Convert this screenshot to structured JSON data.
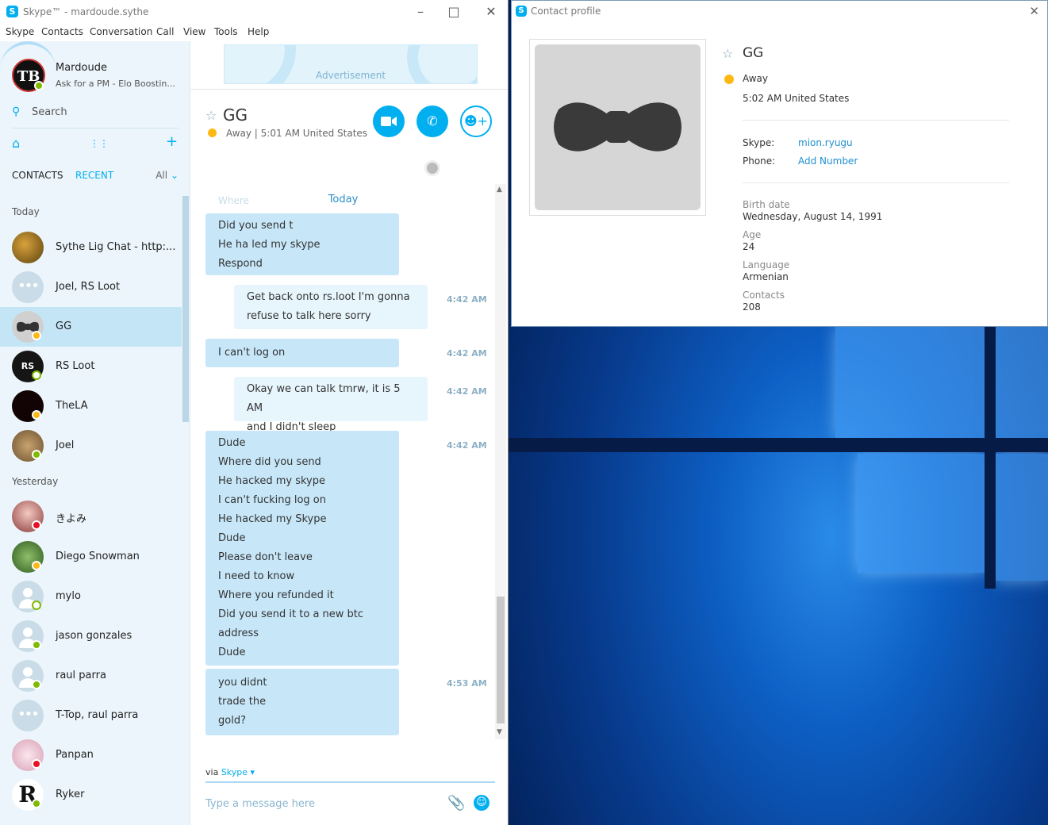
{
  "skype_window": {
    "title": "Skype™ - mardoude.sythe",
    "menu": [
      "Skype",
      "Contacts",
      "Conversation",
      "Call",
      "View",
      "Tools",
      "Help"
    ]
  },
  "me": {
    "name": "Mardoude",
    "mood": "Ask for a PM - Elo Boostin...",
    "avatar_text": "TB",
    "status": "online"
  },
  "search": {
    "label": "Search"
  },
  "tabs": {
    "contacts": "CONTACTS",
    "recent": "RECENT",
    "filter": "All"
  },
  "sections": {
    "today": "Today",
    "yesterday": "Yesterday"
  },
  "recent_today": [
    {
      "name": "Sythe Lig Chat - http:...",
      "avatar": "image",
      "status": ""
    },
    {
      "name": "Joel, RS Loot",
      "avatar": "group",
      "status": ""
    },
    {
      "name": "GG",
      "avatar": "bowtie",
      "status": "away",
      "selected": true
    },
    {
      "name": "RS Loot",
      "avatar": "image",
      "status": "offline"
    },
    {
      "name": "TheLA",
      "avatar": "image",
      "status": "away"
    },
    {
      "name": "Joel",
      "avatar": "image",
      "status": "online"
    }
  ],
  "recent_yesterday": [
    {
      "name": "きよみ",
      "avatar": "image",
      "status": "busy"
    },
    {
      "name": "Diego Snowman",
      "avatar": "image",
      "status": "away"
    },
    {
      "name": "mylo",
      "avatar": "generic",
      "status": "offline"
    },
    {
      "name": "jason gonzales",
      "avatar": "generic",
      "status": "online"
    },
    {
      "name": "raul parra",
      "avatar": "generic",
      "status": "online"
    },
    {
      "name": "T-Top, raul parra",
      "avatar": "group",
      "status": ""
    },
    {
      "name": "Panpan",
      "avatar": "image",
      "status": "busy"
    },
    {
      "name": "Ryker",
      "avatar": "image",
      "status": "online"
    }
  ],
  "ad": {
    "label": "Advertisement"
  },
  "conversation": {
    "contact_name": "GG",
    "status_line": "Away  |  5:01 AM United States",
    "today_label": "Today",
    "faded_lines": [
      "Where"
    ],
    "messages": [
      {
        "from": "them",
        "lines": [
          "Did you send t",
          "He ha led my skype",
          "Respond"
        ],
        "time": ""
      },
      {
        "from": "me",
        "lines": [
          "Get back onto rs.loot I'm gonna",
          "refuse to talk here sorry"
        ],
        "time": "4:42 AM"
      },
      {
        "from": "them",
        "lines": [
          "I can't log on"
        ],
        "time": "4:42 AM"
      },
      {
        "from": "me",
        "lines": [
          "Okay we can talk tmrw, it is 5 AM",
          "and I didn't sleep"
        ],
        "time": "4:42 AM"
      },
      {
        "from": "them",
        "lines": [
          "Dude",
          "Where did you send",
          "He hacked my skype",
          "I can't fucking log on",
          "He hacked my Skype",
          "Dude",
          "Please don't leave",
          "I need to know",
          "Where you refunded it",
          "Did you send it to a new btc",
          "address",
          "Dude"
        ],
        "time": "4:42 AM"
      },
      {
        "from": "them",
        "lines": [
          "you didnt",
          "trade the",
          "gold?"
        ],
        "time": "4:53 AM"
      }
    ],
    "via_prefix": "via",
    "via_service": "Skype ▾",
    "compose_placeholder": "Type a message here"
  },
  "contact_profile": {
    "title": "Contact profile",
    "name": "GG",
    "status": "Away",
    "local_time": "5:02 AM United States",
    "skype_label": "Skype:",
    "skype_value": "mion.ryugu",
    "phone_label": "Phone:",
    "phone_value": "Add Number",
    "fields": [
      {
        "label": "Birth date",
        "value": "Wednesday, August 14, 1991"
      },
      {
        "label": "Age",
        "value": "24"
      },
      {
        "label": "Language",
        "value": "Armenian"
      },
      {
        "label": "Contacts",
        "value": "208"
      }
    ]
  },
  "colors": {
    "skype_blue": "#00aff0",
    "bubble_them": "#c7e7f9",
    "bubble_me": "#e7f5fd",
    "away": "#fdb813",
    "online": "#7fba00",
    "busy": "#e81123"
  }
}
